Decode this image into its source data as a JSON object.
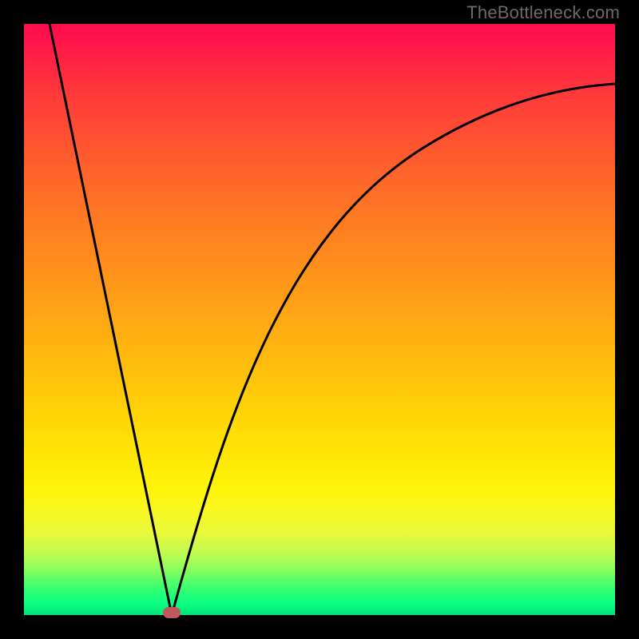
{
  "watermark": "TheBottleneck.com",
  "colors": {
    "frame": "#000000",
    "curve": "#000000",
    "dot": "#c1595c"
  },
  "chart_data": {
    "type": "line",
    "title": "",
    "xlabel": "",
    "ylabel": "",
    "xlim": [
      0,
      100
    ],
    "ylim": [
      0,
      100
    ],
    "grid": false,
    "legend": false,
    "series": [
      {
        "name": "bottleneck-curve-left",
        "x": [
          5,
          10,
          15,
          20,
          25
        ],
        "values": [
          100,
          75,
          50,
          25,
          0
        ]
      },
      {
        "name": "bottleneck-curve-right",
        "x": [
          25,
          30,
          35,
          40,
          45,
          50,
          55,
          60,
          65,
          70,
          75,
          80,
          85,
          90,
          95,
          100
        ],
        "values": [
          0,
          22,
          38,
          50,
          59,
          66,
          71,
          75,
          78,
          81,
          83,
          85,
          86,
          87,
          88,
          89
        ]
      }
    ],
    "minimum": {
      "x": 25,
      "y": 0
    }
  }
}
